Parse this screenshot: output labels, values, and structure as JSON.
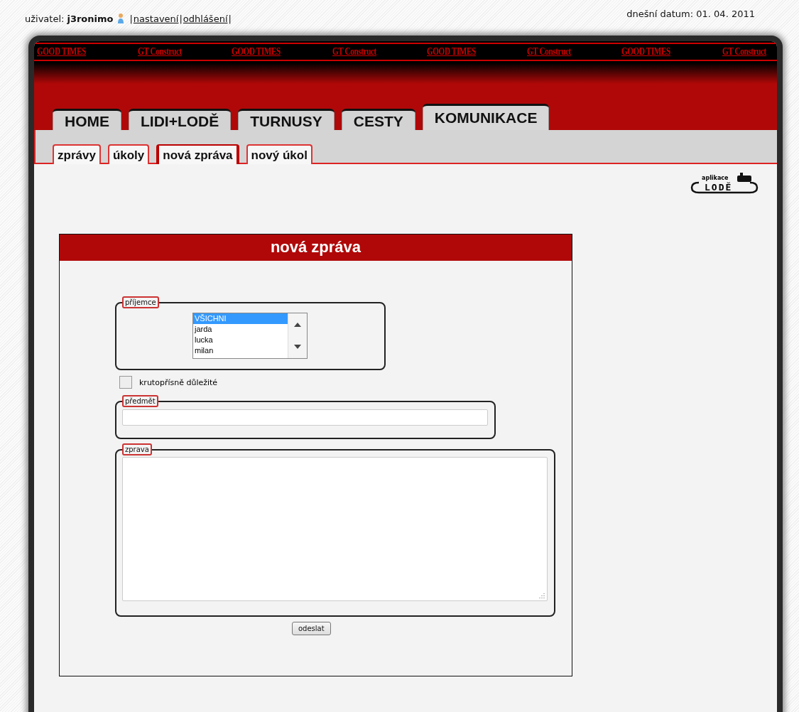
{
  "top_bar": {
    "user_label": "uživatel:",
    "user_name": "j3ronimo",
    "items": [
      {
        "kind": "sep",
        "text": "|"
      },
      {
        "kind": "link",
        "text": "nastavení"
      },
      {
        "kind": "sep",
        "text": "|"
      },
      {
        "kind": "link",
        "text": "odhlášení"
      },
      {
        "kind": "sep",
        "text": "|"
      }
    ],
    "date": "dnešní datum: 01. 04. 2011"
  },
  "banner": {
    "texts": [
      "GOOD TIMES",
      "GT Construct",
      "GOOD TIMES",
      "GT Construct",
      "GOOD TIMES",
      "GT Construct",
      "GOOD TIMES",
      "GT Construct"
    ]
  },
  "tabs": [
    {
      "label": "HOME",
      "selected": false
    },
    {
      "label": "LIDI+LODĚ",
      "selected": false
    },
    {
      "label": "TURNUSY",
      "selected": false
    },
    {
      "label": "CESTY",
      "selected": false
    },
    {
      "label": "KOMUNIKACE",
      "selected": true
    }
  ],
  "subtabs": [
    {
      "label": "zprávy",
      "selected": false
    },
    {
      "label": "úkoly",
      "selected": false
    },
    {
      "label": "nová zpráva",
      "selected": true
    },
    {
      "label": "nový úkol",
      "selected": false
    }
  ],
  "logo": {
    "small": "aplikace",
    "text": "LODĚ"
  },
  "panel": {
    "title": "nová zpráva",
    "recipients": {
      "legend": "příjemce",
      "options": [
        {
          "label": "VŠICHNI",
          "selected": true
        },
        {
          "label": "jarda",
          "selected": false
        },
        {
          "label": "lucka",
          "selected": false
        },
        {
          "label": "milan",
          "selected": false
        }
      ]
    },
    "important": {
      "label": "krutopřísně důležité",
      "checked": false
    },
    "subject": {
      "legend": "předmět"
    },
    "message": {
      "legend": "zprava"
    },
    "submit": "odeslat"
  }
}
